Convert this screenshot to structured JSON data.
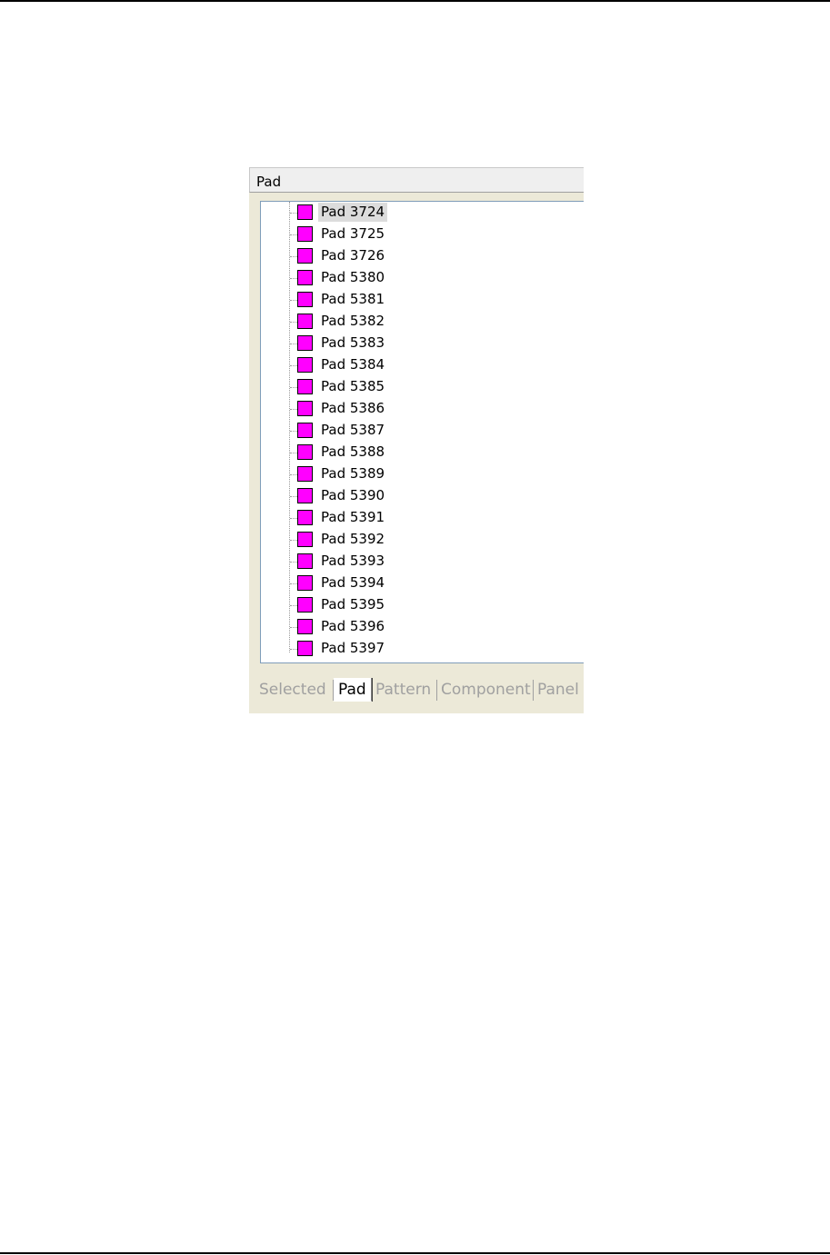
{
  "panel": {
    "header_label": "Pad",
    "tree_items": [
      {
        "label": "Pad 3724",
        "selected": true
      },
      {
        "label": "Pad 3725"
      },
      {
        "label": "Pad 3726"
      },
      {
        "label": "Pad 5380"
      },
      {
        "label": "Pad 5381"
      },
      {
        "label": "Pad 5382"
      },
      {
        "label": "Pad 5383"
      },
      {
        "label": "Pad 5384"
      },
      {
        "label": "Pad 5385"
      },
      {
        "label": "Pad 5386"
      },
      {
        "label": "Pad 5387"
      },
      {
        "label": "Pad 5388"
      },
      {
        "label": "Pad 5389"
      },
      {
        "label": "Pad 5390"
      },
      {
        "label": "Pad 5391"
      },
      {
        "label": "Pad 5392"
      },
      {
        "label": "Pad 5393"
      },
      {
        "label": "Pad 5394"
      },
      {
        "label": "Pad 5395"
      },
      {
        "label": "Pad 5396"
      },
      {
        "label": "Pad 5397"
      }
    ],
    "tabs": [
      {
        "label": "Selected"
      },
      {
        "label": "Pad",
        "active": true
      },
      {
        "label": "Pattern"
      },
      {
        "label": "Component"
      },
      {
        "label": "Panel"
      }
    ]
  },
  "colors": {
    "pad_icon": "#ff00ff",
    "selection_highlight": "#dcdcdc",
    "panel_background": "#ece9d8"
  },
  "icons": {
    "tree_item": "pad-square-icon"
  }
}
